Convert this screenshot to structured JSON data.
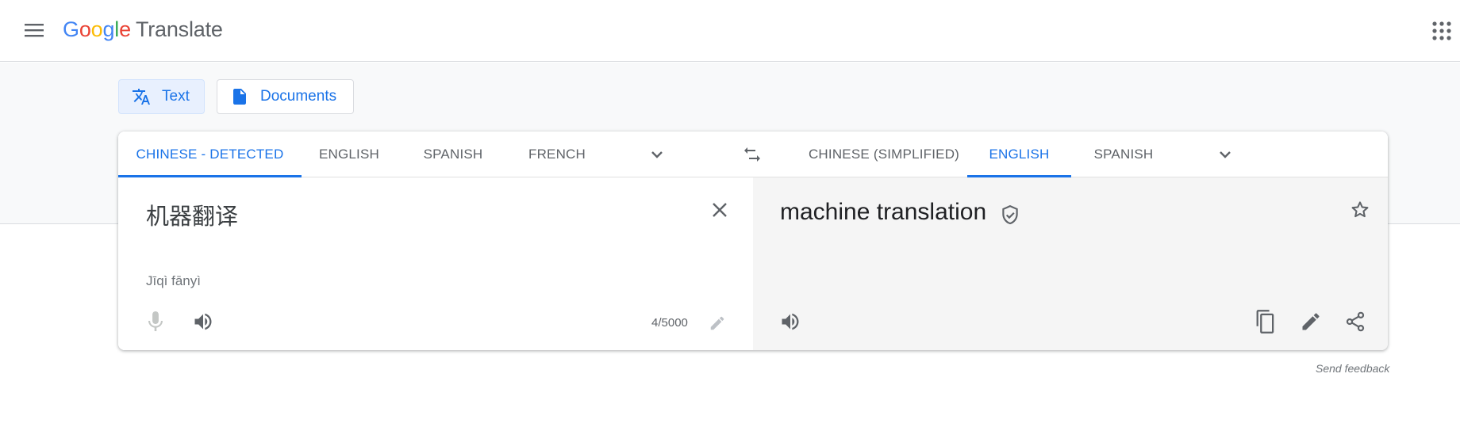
{
  "header": {
    "logo_letters": [
      "G",
      "o",
      "o",
      "g",
      "l",
      "e"
    ],
    "product_name": "Translate"
  },
  "modes": {
    "text_label": "Text",
    "documents_label": "Documents"
  },
  "source_languages": {
    "items": [
      "CHINESE - DETECTED",
      "ENGLISH",
      "SPANISH",
      "FRENCH"
    ],
    "active": "CHINESE - DETECTED"
  },
  "target_languages": {
    "items": [
      "CHINESE (SIMPLIFIED)",
      "ENGLISH",
      "SPANISH"
    ],
    "active": "ENGLISH"
  },
  "source": {
    "text": "机器翻译",
    "romanization": "Jīqì fānyì",
    "char_count": "4/5000"
  },
  "target": {
    "text": "machine translation"
  },
  "footer": {
    "feedback_label": "Send feedback"
  },
  "colors": {
    "accent": "#1a73e8",
    "active_mode_bg": "#e8f0fe",
    "target_panel_bg": "#f5f5f5"
  }
}
